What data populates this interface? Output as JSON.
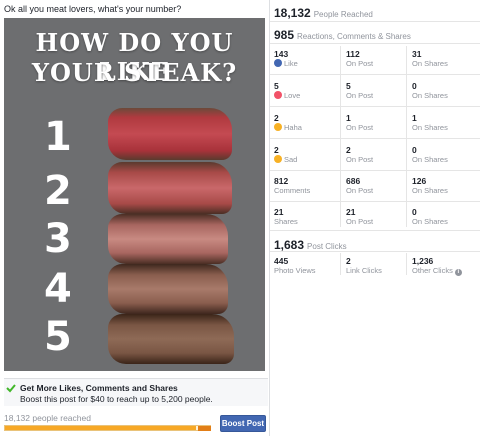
{
  "post": {
    "caption": "Ok all you meat lovers, what's your number?",
    "image": {
      "headline_line1": "HOW DO YOU LIKE",
      "headline_line2": "YOUR STEAK?",
      "ranks": [
        "1",
        "2",
        "3",
        "4",
        "5"
      ]
    },
    "boost_promo": {
      "title": "Get More Likes, Comments and Shares",
      "subtitle": "Boost this post for $40 to reach up to 5,200 people."
    },
    "reach_text": "18,132 people reached",
    "reach_progress": 0.93,
    "boost_button": "Boost Post"
  },
  "stats": {
    "people_reached": {
      "value": "18,132",
      "label": "People Reached"
    },
    "engagement": {
      "value": "985",
      "label": "Reactions, Comments & Shares"
    },
    "rows": [
      {
        "total": "143",
        "label": "Like",
        "icon": "like-icon",
        "on_post": "112",
        "on_shares": "31"
      },
      {
        "total": "5",
        "label": "Love",
        "icon": "love-icon",
        "on_post": "5",
        "on_shares": "0"
      },
      {
        "total": "2",
        "label": "Haha",
        "icon": "haha-icon",
        "on_post": "1",
        "on_shares": "1"
      },
      {
        "total": "2",
        "label": "Sad",
        "icon": "sad-icon",
        "on_post": "2",
        "on_shares": "0"
      },
      {
        "total": "812",
        "label": "Comments",
        "icon": "",
        "on_post": "686",
        "on_shares": "126"
      },
      {
        "total": "21",
        "label": "Shares",
        "icon": "",
        "on_post": "21",
        "on_shares": "0"
      }
    ],
    "on_post_label": "On Post",
    "on_shares_label": "On Shares",
    "post_clicks": {
      "value": "1,683",
      "label": "Post Clicks"
    },
    "clicks": [
      {
        "value": "445",
        "label": "Photo Views"
      },
      {
        "value": "2",
        "label": "Link Clicks"
      },
      {
        "value": "1,236",
        "label": "Other Clicks"
      }
    ]
  },
  "colors": {
    "like": "#4267b2",
    "love": "#f25268",
    "haha": "#f7b125",
    "sad": "#f7b125",
    "boost_button": "#4267b2",
    "reach_bar": "#f7a826"
  }
}
